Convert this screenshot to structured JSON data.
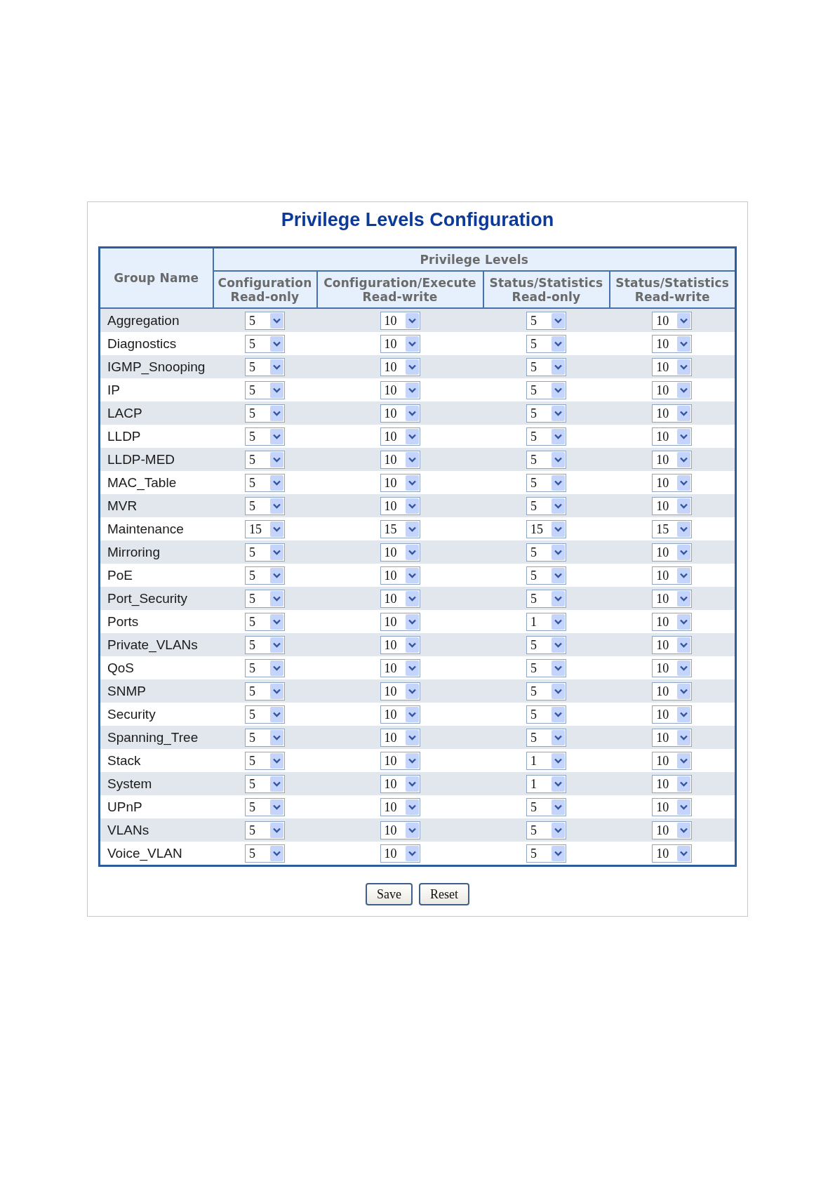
{
  "title": "Privilege Levels Configuration",
  "table": {
    "group_header": "Group Name",
    "levels_header": "Privilege Levels",
    "columns": [
      {
        "lines": [
          "Configuration",
          "Read-only"
        ]
      },
      {
        "lines": [
          "Configuration/Execute",
          "Read-write"
        ]
      },
      {
        "lines": [
          "Status/Statistics",
          "Read-only"
        ]
      },
      {
        "lines": [
          "Status/Statistics",
          "Read-write"
        ]
      }
    ],
    "rows": [
      {
        "group": "Aggregation",
        "levels": [
          "5",
          "10",
          "5",
          "10"
        ]
      },
      {
        "group": "Diagnostics",
        "levels": [
          "5",
          "10",
          "5",
          "10"
        ]
      },
      {
        "group": "IGMP_Snooping",
        "levels": [
          "5",
          "10",
          "5",
          "10"
        ]
      },
      {
        "group": "IP",
        "levels": [
          "5",
          "10",
          "5",
          "10"
        ]
      },
      {
        "group": "LACP",
        "levels": [
          "5",
          "10",
          "5",
          "10"
        ]
      },
      {
        "group": "LLDP",
        "levels": [
          "5",
          "10",
          "5",
          "10"
        ]
      },
      {
        "group": "LLDP-MED",
        "levels": [
          "5",
          "10",
          "5",
          "10"
        ]
      },
      {
        "group": "MAC_Table",
        "levels": [
          "5",
          "10",
          "5",
          "10"
        ]
      },
      {
        "group": "MVR",
        "levels": [
          "5",
          "10",
          "5",
          "10"
        ]
      },
      {
        "group": "Maintenance",
        "levels": [
          "15",
          "15",
          "15",
          "15"
        ]
      },
      {
        "group": "Mirroring",
        "levels": [
          "5",
          "10",
          "5",
          "10"
        ]
      },
      {
        "group": "PoE",
        "levels": [
          "5",
          "10",
          "5",
          "10"
        ]
      },
      {
        "group": "Port_Security",
        "levels": [
          "5",
          "10",
          "5",
          "10"
        ]
      },
      {
        "group": "Ports",
        "levels": [
          "5",
          "10",
          "1",
          "10"
        ]
      },
      {
        "group": "Private_VLANs",
        "levels": [
          "5",
          "10",
          "5",
          "10"
        ]
      },
      {
        "group": "QoS",
        "levels": [
          "5",
          "10",
          "5",
          "10"
        ]
      },
      {
        "group": "SNMP",
        "levels": [
          "5",
          "10",
          "5",
          "10"
        ]
      },
      {
        "group": "Security",
        "levels": [
          "5",
          "10",
          "5",
          "10"
        ]
      },
      {
        "group": "Spanning_Tree",
        "levels": [
          "5",
          "10",
          "5",
          "10"
        ]
      },
      {
        "group": "Stack",
        "levels": [
          "5",
          "10",
          "1",
          "10"
        ]
      },
      {
        "group": "System",
        "levels": [
          "5",
          "10",
          "1",
          "10"
        ]
      },
      {
        "group": "UPnP",
        "levels": [
          "5",
          "10",
          "5",
          "10"
        ]
      },
      {
        "group": "VLANs",
        "levels": [
          "5",
          "10",
          "5",
          "10"
        ]
      },
      {
        "group": "Voice_VLAN",
        "levels": [
          "5",
          "10",
          "5",
          "10"
        ]
      }
    ]
  },
  "buttons": [
    "Save",
    "Reset"
  ]
}
